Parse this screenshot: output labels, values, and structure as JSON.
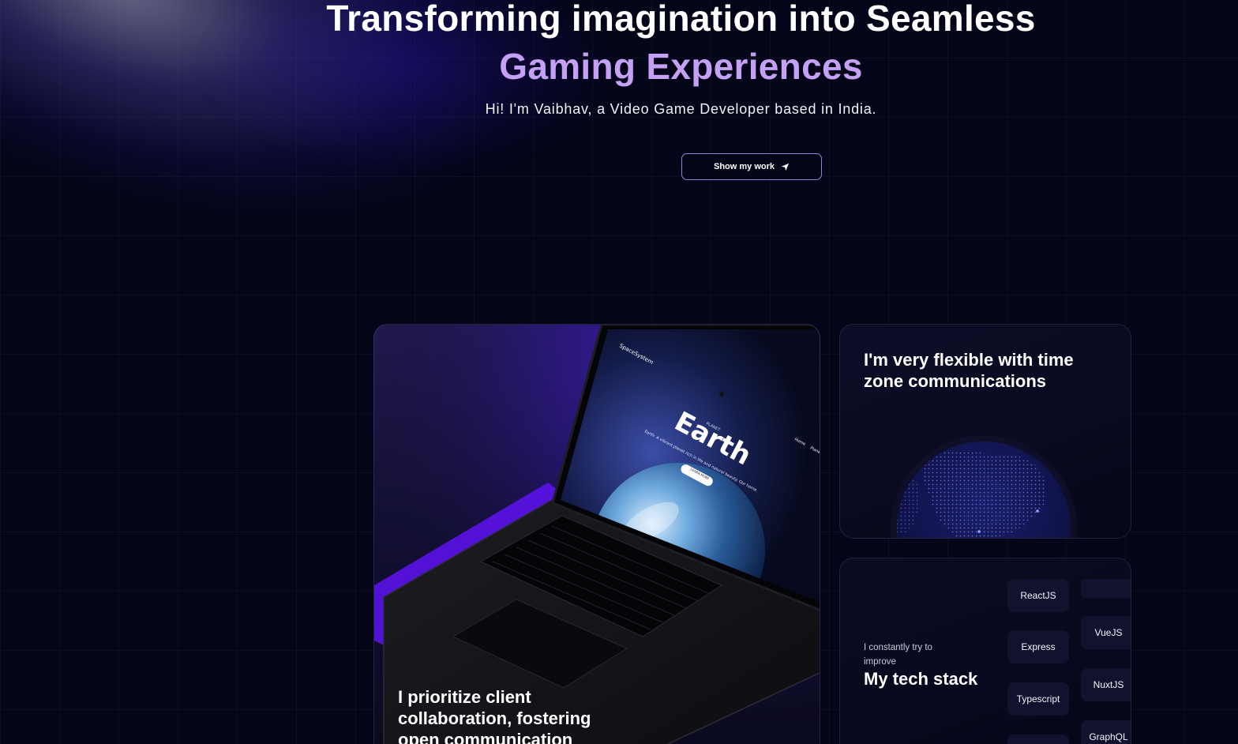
{
  "hero": {
    "title_line1": "Transforming imagination into Seamless",
    "title_line2": "Gaming Experiences",
    "subtitle": "Hi! I'm Vaibhav, a Video Game Developer based in India.",
    "cta_label": "Show my work",
    "cta_icon": "location-arrow-icon"
  },
  "cards": {
    "laptop_caption": "I prioritize client collaboration, fostering open communication",
    "timezone_title": "I'm very flexible with time zone communications",
    "stack_kicker": "I constantly try to improve",
    "stack_title": "My tech stack",
    "stack_left": [
      "ReactJS",
      "Express",
      "Typescript",
      ""
    ],
    "stack_right": [
      "",
      "VueJS",
      "NuxtJS",
      "GraphQL"
    ]
  },
  "laptop_screen": {
    "brand": "SpaceSystem",
    "planet_kicker": "PLANET",
    "planet_name": "Earth",
    "tagline": "Earth: A vibrant planet rich in life and natural beauty. Our home.",
    "button": "LEARN MORE",
    "nav": [
      "Home",
      "Planets"
    ]
  },
  "colors": {
    "accent_purple": "#c4a1f5",
    "background": "#05051a",
    "border": "#8f84d6",
    "violet_glow": "#5b12e8"
  }
}
